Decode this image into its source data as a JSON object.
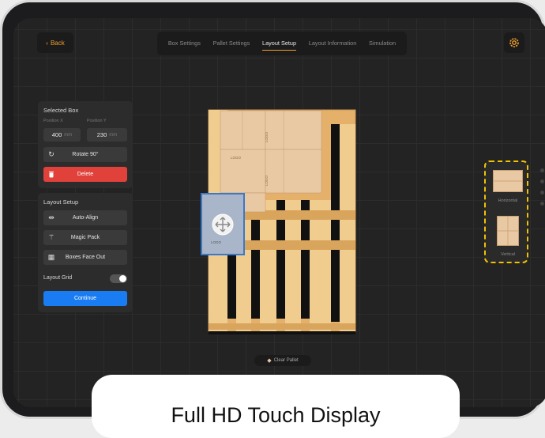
{
  "header": {
    "back_label": "Back",
    "tabs": [
      {
        "label": "Box Settings"
      },
      {
        "label": "Pallet Settings"
      },
      {
        "label": "Layout Setup"
      },
      {
        "label": "Layout Information"
      },
      {
        "label": "Simulation"
      }
    ],
    "active_tab": "Layout Setup"
  },
  "selected_box": {
    "title": "Selected Box",
    "position_x_label": "Position X",
    "position_y_label": "Position Y",
    "position_x_value": "400",
    "position_y_value": "230",
    "unit": "mm",
    "rotate_label": "Rotate 90°",
    "delete_label": "Delete"
  },
  "layout_setup": {
    "title": "Layout Setup",
    "auto_align_label": "Auto-Align",
    "magic_pack_label": "Magic Pack",
    "boxes_face_out_label": "Boxes Face Out",
    "layout_grid_label": "Layout Grid",
    "layout_grid_on": true,
    "continue_label": "Continue"
  },
  "orientation": {
    "horizontal_label": "Horizontal",
    "vertical_label": "Vertical"
  },
  "canvas": {
    "box_label": "LOGO",
    "clear_pallet_label": "Clear Pallet"
  },
  "caption": "Full HD Touch Display",
  "colors": {
    "accent": "#f0a030",
    "delete": "#e0413a",
    "continue": "#1a7cf2",
    "box": "#e9c9a4",
    "pallet": "#e4b06a",
    "selected": "#9fb0cc"
  },
  "icons": [
    "chevron-left-icon",
    "gear-icon",
    "rotate-icon",
    "trash-icon",
    "align-icon",
    "magic-wand-icon",
    "grid-icon",
    "move-icon",
    "pallet-icon"
  ]
}
